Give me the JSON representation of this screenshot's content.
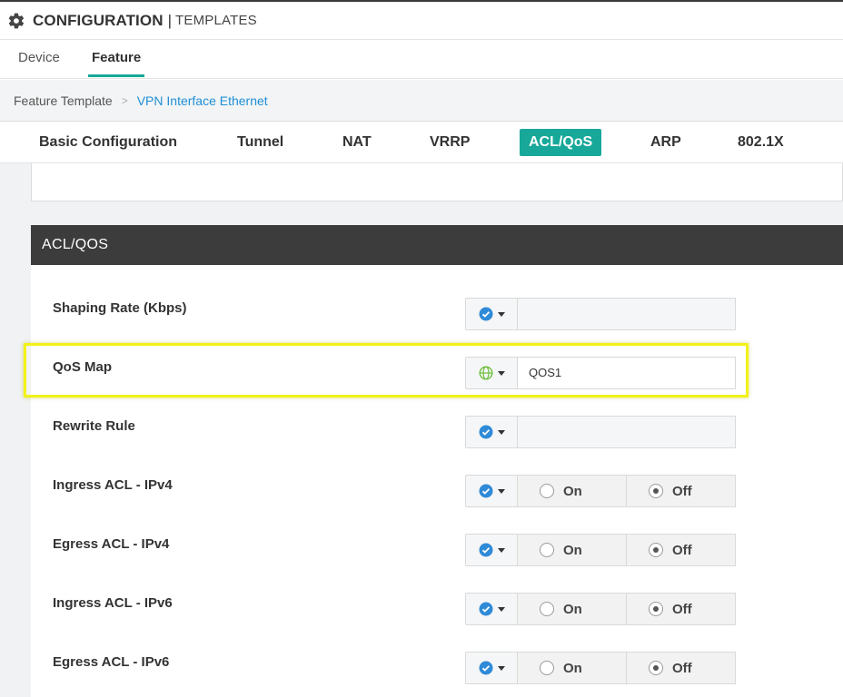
{
  "header": {
    "icon": "gear-icon",
    "title": "CONFIGURATION",
    "separator": "|",
    "subtitle": "TEMPLATES"
  },
  "top_tabs": [
    {
      "label": "Device",
      "active": false
    },
    {
      "label": "Feature",
      "active": true
    }
  ],
  "breadcrumb": {
    "root": "Feature Template",
    "separator": ">",
    "current": "VPN Interface Ethernet"
  },
  "section_tabs": [
    {
      "label": "Basic Configuration",
      "active": false
    },
    {
      "label": "Tunnel",
      "active": false
    },
    {
      "label": "NAT",
      "active": false
    },
    {
      "label": "VRRP",
      "active": false
    },
    {
      "label": "ACL/QoS",
      "active": true
    },
    {
      "label": "ARP",
      "active": false
    },
    {
      "label": "802.1X",
      "active": false
    }
  ],
  "panel": {
    "title": "ACL/QOS",
    "rows": [
      {
        "label": "Shaping Rate (Kbps)",
        "scope_icon": "check-circle-icon",
        "type": "text",
        "value": ""
      },
      {
        "label": "QoS Map",
        "scope_icon": "globe-icon",
        "type": "text",
        "value": "QOS1"
      },
      {
        "label": "Rewrite Rule",
        "scope_icon": "check-circle-icon",
        "type": "text",
        "value": ""
      },
      {
        "label": "Ingress ACL - IPv4",
        "scope_icon": "check-circle-icon",
        "type": "radio",
        "on_label": "On",
        "off_label": "Off",
        "selected": "Off"
      },
      {
        "label": "Egress ACL - IPv4",
        "scope_icon": "check-circle-icon",
        "type": "radio",
        "on_label": "On",
        "off_label": "Off",
        "selected": "Off"
      },
      {
        "label": "Ingress ACL - IPv6",
        "scope_icon": "check-circle-icon",
        "type": "radio",
        "on_label": "On",
        "off_label": "Off",
        "selected": "Off"
      },
      {
        "label": "Egress ACL - IPv6",
        "scope_icon": "check-circle-icon",
        "type": "radio",
        "on_label": "On",
        "off_label": "Off",
        "selected": "Off"
      }
    ]
  },
  "colors": {
    "accent": "#17a89a",
    "link": "#1f8fd6",
    "panel_header": "#3c3c3c",
    "highlight": "#f2f21a",
    "check_icon": "#2f8ad8",
    "globe_icon": "#6cbf3a"
  }
}
